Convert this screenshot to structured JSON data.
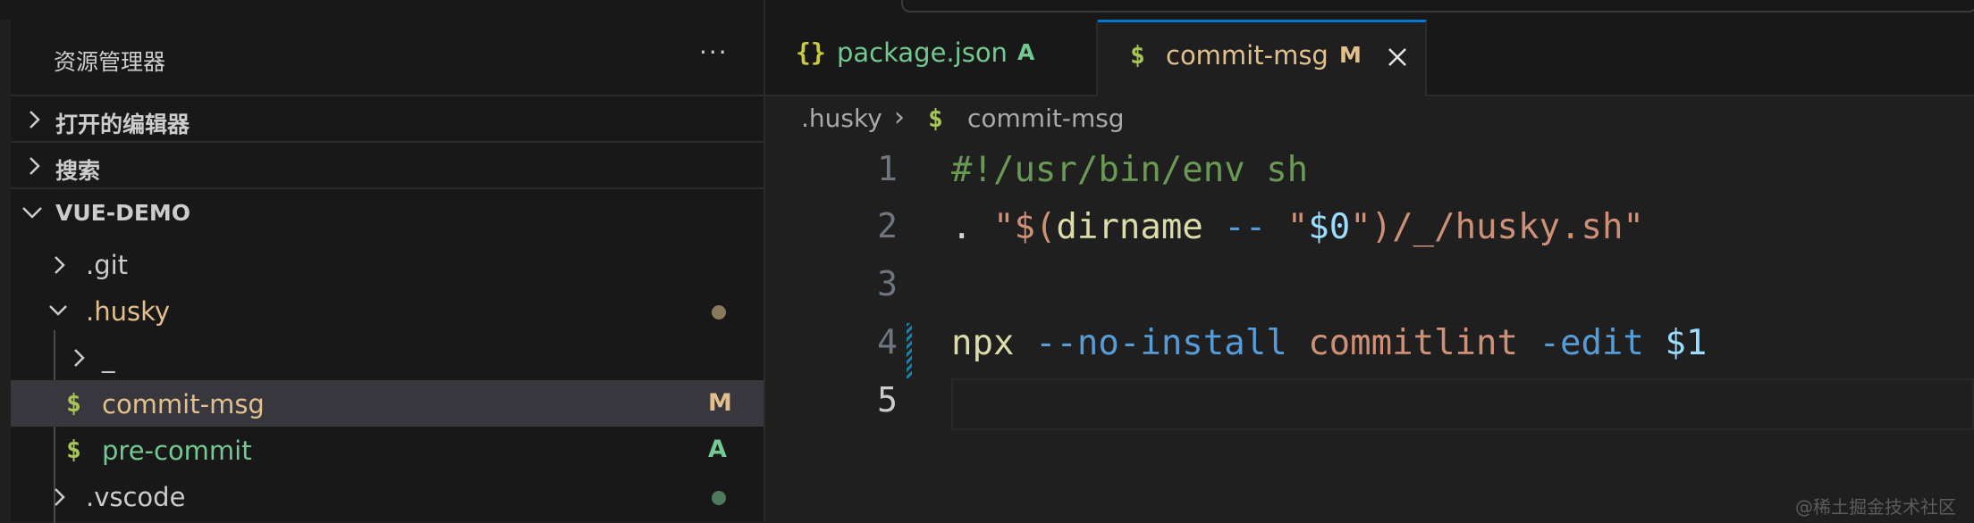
{
  "explorer": {
    "title": "资源管理器",
    "more": "···",
    "sections": {
      "open_editors": "打开的编辑器",
      "search": "搜索",
      "project": "VUE-DEMO"
    },
    "tree": [
      {
        "label": ".git",
        "type": "folder",
        "expanded": false
      },
      {
        "label": ".husky",
        "type": "folder",
        "expanded": true,
        "status": "modified-dot"
      },
      {
        "label": "_",
        "type": "folder",
        "expanded": false
      },
      {
        "label": "commit-msg",
        "type": "file",
        "icon": "$",
        "status": "M",
        "selected": true
      },
      {
        "label": "pre-commit",
        "type": "file",
        "icon": "$",
        "status": "A"
      },
      {
        "label": ".vscode",
        "type": "folder",
        "expanded": false,
        "status": "added-dot"
      }
    ]
  },
  "tabs": [
    {
      "icon": "{}",
      "label": "package.json",
      "status": "A",
      "active": false
    },
    {
      "icon": "$",
      "label": "commit-msg",
      "status": "M",
      "active": true
    }
  ],
  "breadcrumb": {
    "folder": ".husky",
    "sep": "›",
    "icon": "$",
    "file": "commit-msg"
  },
  "code": {
    "line_numbers": [
      "1",
      "2",
      "3",
      "4",
      "5"
    ],
    "line1": "#!/usr/bin/env sh",
    "line2": {
      "dot": ". ",
      "q1": "\"$(",
      "cmd": "dirname",
      "sp": " ",
      "dd": "--",
      "sp2": " ",
      "q2": "\"",
      "var": "$0",
      "rest": "\")/_/husky.sh\""
    },
    "line4": {
      "cmd": "npx",
      "sp1": " ",
      "flag1": "--no-install",
      "sp2": " ",
      "arg": "commitlint",
      "sp3": " ",
      "flag2": "-edit",
      "sp4": " ",
      "var": "$1"
    }
  },
  "watermark": "@稀土掘金技术社区",
  "colors": {
    "modified": "#e2c08d",
    "added": "#73c991",
    "shell_icon": "#a6c655",
    "json_icon": "#cbcb41",
    "accent": "#0078d4"
  }
}
